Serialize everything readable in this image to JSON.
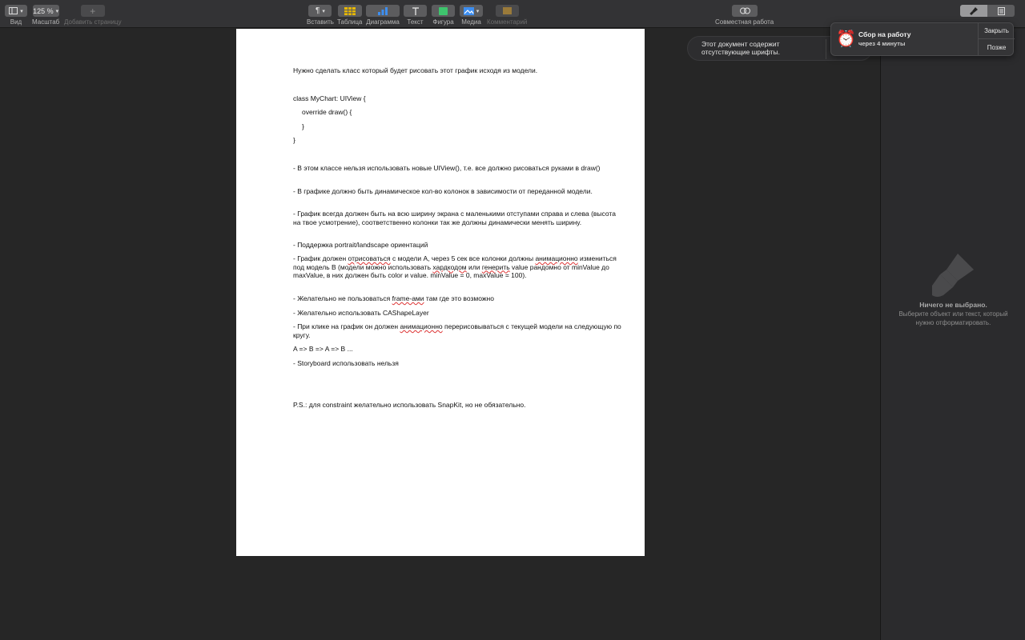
{
  "toolbar": {
    "view_label": "Вид",
    "zoom_value": "125 %",
    "zoom_label": "Масштаб",
    "add_page_label": "Добавить страницу",
    "insert_label": "Вставить",
    "table_label": "Таблица",
    "chart_label": "Диаграмма",
    "text_label": "Текст",
    "shape_label": "Фигура",
    "media_label": "Медиа",
    "comment_label": "Комментарий",
    "collab_label": "Совместная работа",
    "format_label": "Формат",
    "document_label": "Документ"
  },
  "document": {
    "intro": "Нужно сделать класс который будет рисовать этот график исходя из модели.",
    "code": [
      "class MyChart: UIView {",
      "override draw() {",
      "}",
      "}"
    ],
    "p1": "- В этом классе нельзя использовать новые UIView(), т.е. все должно рисоваться руками в draw()",
    "p2": "- В графике должно быть динамическое кол-во колонок в зависимости от переданной модели.",
    "p3": "- График всегда должен быть на всю ширину экрана с маленькими отступами справа и слева (высота на твое усмотрение), соответственно колонки так же должны динамически менять ширину.",
    "p4": "- Поддержка portrait/landscape ориентаций",
    "p5": {
      "a": "- График должен ",
      "b": "отрисоваться",
      "c": " с модели А, через 5 сек все колонки должны ",
      "d": "анимационно",
      "e": " измениться под модель B (модели можно использовать ",
      "f": "хардкодом",
      "g": " или ",
      "h": "генерить",
      "i": " value рандомно от minValue до maxValue, в них должен быть color и value. minValue = 0, maxValue = 100)."
    },
    "p6": {
      "a": "- Желательно не пользоваться ",
      "b": "frame-ами",
      "c": " там где это возможно"
    },
    "p7": "- Желательно использовать CAShapeLayer",
    "p8": {
      "a": "- При клике на график он должен ",
      "b": "анимационно",
      "c": " перерисовываться с текущей модели на следующую по кругу."
    },
    "p9": "A => B => A => B ...",
    "p10": "- Storyboard использовать нельзя",
    "ps": "P.S.: для constraint желательно использовать SnapKit, но не обязательно."
  },
  "alert": {
    "text": "Этот документ содержит отсутствующие шрифты."
  },
  "notification": {
    "title": "Сбор на работу",
    "subtitle": "через 4 минуты",
    "close_label": "Закрыть",
    "later_label": "Позже"
  },
  "inspector": {
    "empty_title": "Ничего не выбрано.",
    "empty_subtitle": "Выберите объект или текст, который нужно отформатировать."
  }
}
